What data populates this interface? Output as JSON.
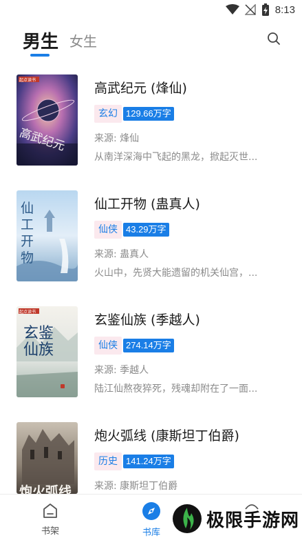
{
  "status_bar": {
    "time": "8:13",
    "icons": [
      "wifi-icon",
      "no-signal-icon",
      "battery-charging-icon"
    ]
  },
  "header": {
    "tabs": [
      {
        "label": "男生",
        "active": true
      },
      {
        "label": "女生",
        "active": false
      }
    ],
    "search_icon": "search-icon"
  },
  "books": [
    {
      "title": "高武纪元 (烽仙)",
      "genre": "玄幻",
      "word_count": "129.66万字",
      "source": "来源: 烽仙",
      "intro": "从南洋深海中飞起的黑龙，掀起灭世...",
      "cover_text": "高武纪元",
      "cover_badge": "起点读书"
    },
    {
      "title": "仙工开物 (蛊真人)",
      "genre": "仙侠",
      "word_count": "43.29万字",
      "source": "来源: 蛊真人",
      "intro": "火山中，先贤大能遗留的机关仙宫，...",
      "cover_text": "仙工开物"
    },
    {
      "title": "玄鉴仙族 (季越人)",
      "genre": "仙侠",
      "word_count": "274.14万字",
      "source": "来源: 季越人",
      "intro": "陆江仙熬夜猝死，残魂却附在了一面...",
      "cover_text": "玄鉴仙族",
      "cover_badge": "起点读书"
    },
    {
      "title": "炮火弧线 (康斯坦丁伯爵)",
      "genre": "历史",
      "word_count": "141.24万字",
      "source": "来源: 康斯坦丁伯爵",
      "intro": "",
      "cover_text": "炮火弧线"
    }
  ],
  "bottom_nav": {
    "items": [
      {
        "label": "书架",
        "icon": "bookshelf-icon",
        "active": false
      },
      {
        "label": "书库",
        "icon": "compass-icon",
        "active": true
      }
    ]
  },
  "watermark": {
    "text": "极限手游网"
  },
  "colors": {
    "accent": "#1a7ee6",
    "tag_bg": "#fbe9ee",
    "muted": "#8a8a8a"
  }
}
